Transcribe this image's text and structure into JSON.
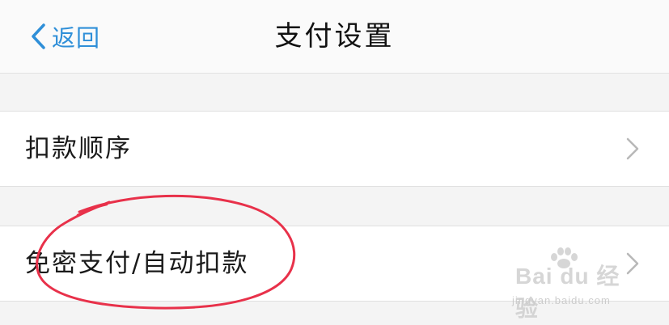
{
  "nav": {
    "back_label": "返回",
    "title": "支付设置"
  },
  "rows": [
    {
      "label": "扣款顺序",
      "icon": "chevron-right-icon"
    },
    {
      "label": "免密支付/自动扣款",
      "icon": "chevron-right-icon"
    }
  ],
  "watermark": {
    "brand": "Bai du 经验",
    "url": "jingyan.baidu.com"
  },
  "colors": {
    "accent": "#2f8fd8",
    "annotation": "#e8314a",
    "background": "#f4f4f4",
    "row_background": "#ffffff"
  }
}
